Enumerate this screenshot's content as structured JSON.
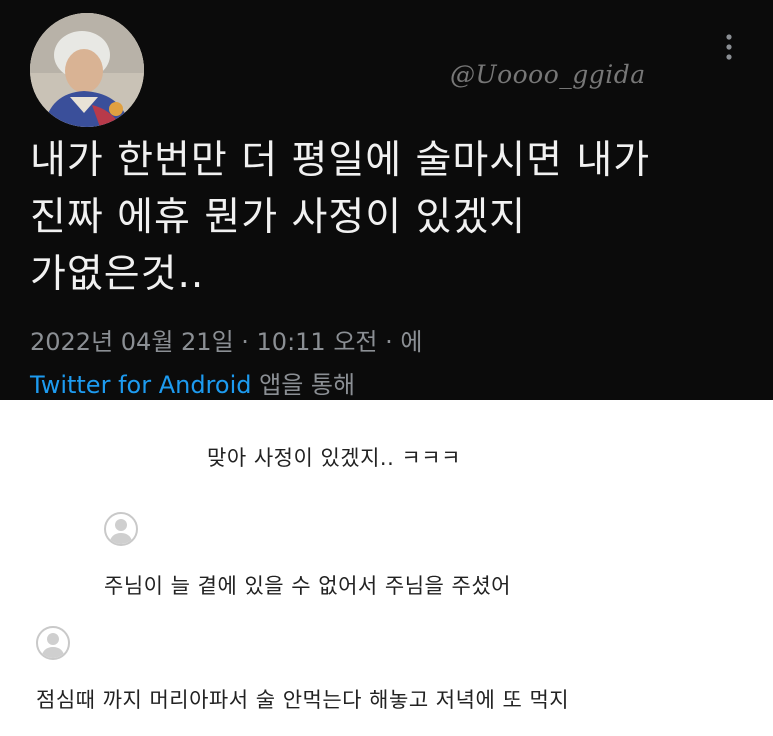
{
  "tweet": {
    "handle_watermark": "@Uoooo_ggida",
    "text_lines": [
      "내가 한번만 더 평일에 술마시면 내가",
      "진짜 에휴 뭔가 사정이 있겠지",
      "가엾은것.."
    ],
    "timestamp": "2022년 04월 21일 · 10:11 오전 · 에",
    "client_name": "Twitter for Android",
    "client_suffix": "앱을 통해",
    "more_icon": "vertical-ellipsis-icon",
    "background": "#0b0b0b",
    "link_color": "#1d9bf0"
  },
  "comments": [
    {
      "text": "맞아 사정이 있겠지.. ㅋㅋㅋ",
      "avatar": false
    },
    {
      "text": "주님이 늘 곁에 있을 수 없어서 주님을 주셨어",
      "avatar": true,
      "avatar_icon": "default-user-icon"
    },
    {
      "text": "점심때 까지 머리아파서 술 안먹는다 해놓고 저녁에 또 먹지",
      "avatar": true,
      "avatar_icon": "default-user-icon"
    }
  ]
}
